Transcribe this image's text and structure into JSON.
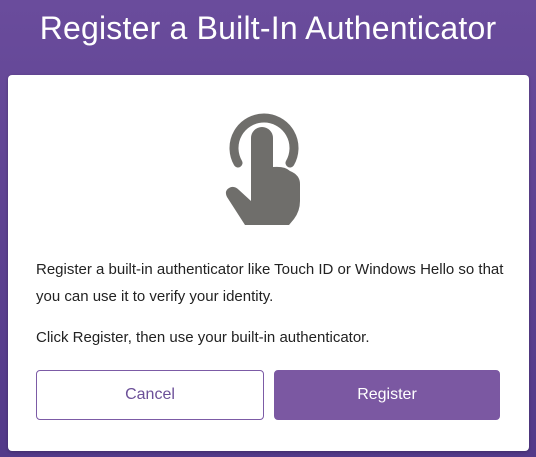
{
  "header": {
    "title": "Register a Built-In Authenticator"
  },
  "card": {
    "icon": "touch-finger-icon",
    "description": "Register a built-in authenticator like Touch ID or Windows Hello so that you can use it to verify your identity.",
    "instruction": "Click Register, then use your built-in authenticator.",
    "cancel_label": "Cancel",
    "register_label": "Register"
  },
  "colors": {
    "background": "#5c4190",
    "accent": "#7b58a2",
    "icon": "#6f6e6b"
  }
}
